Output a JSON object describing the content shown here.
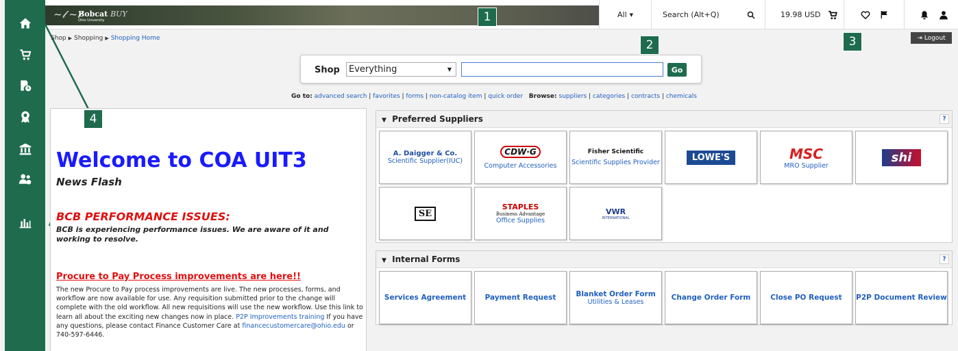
{
  "sidebar": {
    "items": [
      {
        "icon": "home-icon"
      },
      {
        "icon": "cart-icon"
      },
      {
        "icon": "orders-icon"
      },
      {
        "icon": "award-icon"
      },
      {
        "icon": "bank-icon"
      },
      {
        "icon": "users-icon"
      },
      {
        "icon": "chart-icon"
      }
    ]
  },
  "banner": {
    "brand": "Bobcat",
    "brand_suffix": "BUY",
    "subtitle": "Ohio University"
  },
  "topbar": {
    "search_scope": "All",
    "search_placeholder": "Search (Alt+Q)",
    "cart_total": "19.98 USD"
  },
  "callouts": [
    "1",
    "2",
    "3",
    "4"
  ],
  "breadcrumb": {
    "items": [
      "Shop",
      "Shopping"
    ],
    "current": "Shopping Home"
  },
  "logout_label": "Logout",
  "search": {
    "shop_label": "Shop",
    "scope": "Everything",
    "go_label": "Go"
  },
  "goto": {
    "label": "Go to:",
    "links": [
      "advanced search",
      "favorites",
      "forms",
      "non-catalog item",
      "quick order"
    ],
    "browse_label": "Browse:",
    "browse_links": [
      "suppliers",
      "categories",
      "contracts",
      "chemicals"
    ]
  },
  "news": {
    "welcome": "Welcome to COA UIT3",
    "newsflash": "News Flash",
    "bcb_title": "BCB PERFORMANCE ISSUES:",
    "bcb_text": "BCB is experiencing performance issues. We are aware of it and working to resolve.",
    "p2p_title": "Procure to Pay Process improvements are here!!",
    "p2p_text": "The new Procure to Pay process improvements are live. The new processes, forms, and workflow are now available for use.  Any requisition submitted prior to the change will complete with the old workflow.  All new requisitions will use the new workflow.  Use this link to learn all about the exciting new changes now in place.",
    "p2p_link": "P2P Improvements training",
    "p2p_contact": "If you have any questions, please contact Finance Customer Care at",
    "p2p_email": "financecustomercare@ohio.edu",
    "p2p_phone": "or 740-597-6446."
  },
  "preferred_suppliers": {
    "title": "Preferred Suppliers",
    "help": "?",
    "tiles": [
      {
        "logo": "A. Daigger & Co.",
        "label": "Scientific Supplier(IUC)"
      },
      {
        "logo": "CDW·G",
        "label": "Computer Accessories"
      },
      {
        "logo": "Fisher Scientific",
        "label": "Scientific Supplies Provider"
      },
      {
        "logo": "LOWE'S",
        "label": ""
      },
      {
        "logo": "MSC",
        "label": "MRO Supplier"
      },
      {
        "logo": "shi",
        "label": ""
      },
      {
        "logo": "SE",
        "label": ""
      },
      {
        "logo": "STAPLES",
        "logo_sub": "Business Advantage",
        "label": "Office Supplies"
      },
      {
        "logo": "VWR",
        "logo_sub": "INTERNATIONAL",
        "label": ""
      }
    ]
  },
  "internal_forms": {
    "title": "Internal Forms",
    "help": "?",
    "tiles": [
      {
        "label": "Services Agreement",
        "sub": ""
      },
      {
        "label": "Payment Request",
        "sub": ""
      },
      {
        "label": "Blanket Order Form",
        "sub": "Utilities & Leases"
      },
      {
        "label": "Change Order Form",
        "sub": ""
      },
      {
        "label": "Close PO Request",
        "sub": ""
      },
      {
        "label": "P2P Document Review",
        "sub": ""
      }
    ]
  },
  "colors": {
    "brand": "#1e6b4e",
    "link": "#1f5fbf",
    "alert": "#e01010",
    "welcome": "#1a1aff"
  }
}
